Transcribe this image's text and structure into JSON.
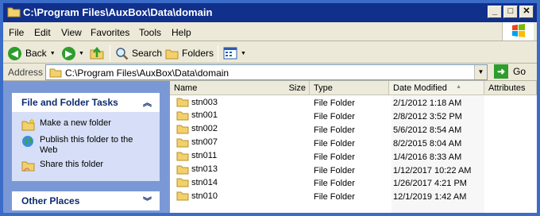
{
  "window": {
    "title": "C:\\Program Files\\AuxBox\\Data\\domain",
    "minimize_glyph": "_",
    "maximize_glyph": "□",
    "close_glyph": "✕"
  },
  "menu": [
    "File",
    "Edit",
    "View",
    "Favorites",
    "Tools",
    "Help"
  ],
  "toolbar": {
    "back_label": "Back",
    "search_label": "Search",
    "folders_label": "Folders"
  },
  "address": {
    "label": "Address",
    "path": "C:\\Program Files\\AuxBox\\Data\\domain",
    "go_label": "Go"
  },
  "tasks": {
    "title": "File and Folder Tasks",
    "items": [
      {
        "label": "Make a new folder",
        "icon": "new-folder-icon"
      },
      {
        "label": "Publish this folder to the Web",
        "icon": "globe-icon"
      },
      {
        "label": "Share this folder",
        "icon": "share-folder-icon"
      }
    ]
  },
  "other_places": {
    "title": "Other Places"
  },
  "columns": [
    "Name",
    "Size",
    "Type",
    "Date Modified",
    "Attributes"
  ],
  "files": [
    {
      "name": "stn003",
      "type": "File Folder",
      "date": "2/1/2012 1:18 AM"
    },
    {
      "name": "stn001",
      "type": "File Folder",
      "date": "2/8/2012 3:52 PM"
    },
    {
      "name": "stn002",
      "type": "File Folder",
      "date": "5/6/2012 8:54 AM"
    },
    {
      "name": "stn007",
      "type": "File Folder",
      "date": "8/2/2015 8:04 AM"
    },
    {
      "name": "stn011",
      "type": "File Folder",
      "date": "1/4/2016 8:33 AM"
    },
    {
      "name": "stn013",
      "type": "File Folder",
      "date": "1/12/2017 10:22 AM"
    },
    {
      "name": "stn014",
      "type": "File Folder",
      "date": "1/26/2017 4:21 PM"
    },
    {
      "name": "stn010",
      "type": "File Folder",
      "date": "12/1/2019 1:42 AM"
    }
  ],
  "colors": {
    "window_frame": "#3a6cc8",
    "title_bar": "#10308c",
    "task_pane": "#7b98d6",
    "task_panel": "#d6dff7",
    "folder": "#f2d16a"
  }
}
